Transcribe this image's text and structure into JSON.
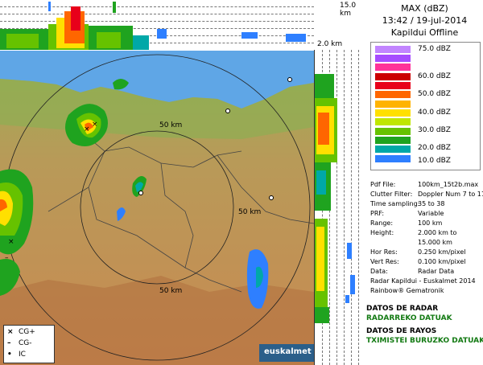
{
  "top_strip": {
    "height_label": "15.0 km"
  },
  "right_strip": {
    "height_label": "2.0 km"
  },
  "map": {
    "range_rings": [
      "50 km",
      "50 km",
      "50 km"
    ],
    "lightning_legend": [
      {
        "symbol": "×",
        "label": "CG+"
      },
      {
        "symbol": "–",
        "label": "CG-"
      },
      {
        "symbol": "•",
        "label": "IC"
      }
    ],
    "logo_text": "euskalmet"
  },
  "header": {
    "product": "MAX (dBZ)",
    "datetime": "13:42 / 19-jul-2014",
    "radar_status": "Kapildui Offline"
  },
  "scale": [
    {
      "label": "75.0 dBZ",
      "color": "#c285ff"
    },
    {
      "label": "",
      "color": "#a64cff"
    },
    {
      "label": "60.0 dBZ",
      "color": "#ff3399"
    },
    {
      "label": "",
      "color": "#cc0000"
    },
    {
      "label": "50.0 dBZ",
      "color": "#e8001a"
    },
    {
      "label": "",
      "color": "#ff6600"
    },
    {
      "label": "40.0 dBZ",
      "color": "#ffb300"
    },
    {
      "label": "",
      "color": "#ffe000"
    },
    {
      "label": "30.0 dBZ",
      "color": "#bfe600"
    },
    {
      "label": "",
      "color": "#66c200"
    },
    {
      "label": "20.0 dBZ",
      "color": "#1fa31f"
    },
    {
      "label": "",
      "color": "#00a8a8"
    },
    {
      "label": "10.0 dBZ",
      "color": "#2e7fff"
    }
  ],
  "info": [
    {
      "key": "Pdf File:",
      "value": "100km_15t2b.max"
    },
    {
      "key": "Clutter Filter:",
      "value": "Doppler Num 7 to 11"
    },
    {
      "key": "Time sampling:",
      "value": "35 to 38"
    },
    {
      "key": "PRF:",
      "value": "Variable"
    },
    {
      "key": "Range:",
      "value": "100 km"
    },
    {
      "key": "Height:",
      "value": "2.000 km to"
    },
    {
      "key": "",
      "value": "15.000 km"
    },
    {
      "key": "Hor Res:",
      "value": "0.250 km/pixel"
    },
    {
      "key": "Vert Res:",
      "value": "0.100 km/pixel"
    },
    {
      "key": "Data:",
      "value": "Radar Data"
    }
  ],
  "credits": [
    "Radar Kapildui - Euskalmet 2014",
    "Rainbow® Gematronik"
  ],
  "footer": {
    "radar_es": "DATOS DE RADAR",
    "radar_eu": "RADARREKO DATUAK",
    "rays_es": "DATOS DE RAYOS",
    "rays_eu": "TXIMISTEI BURUZKO DATUAK"
  }
}
